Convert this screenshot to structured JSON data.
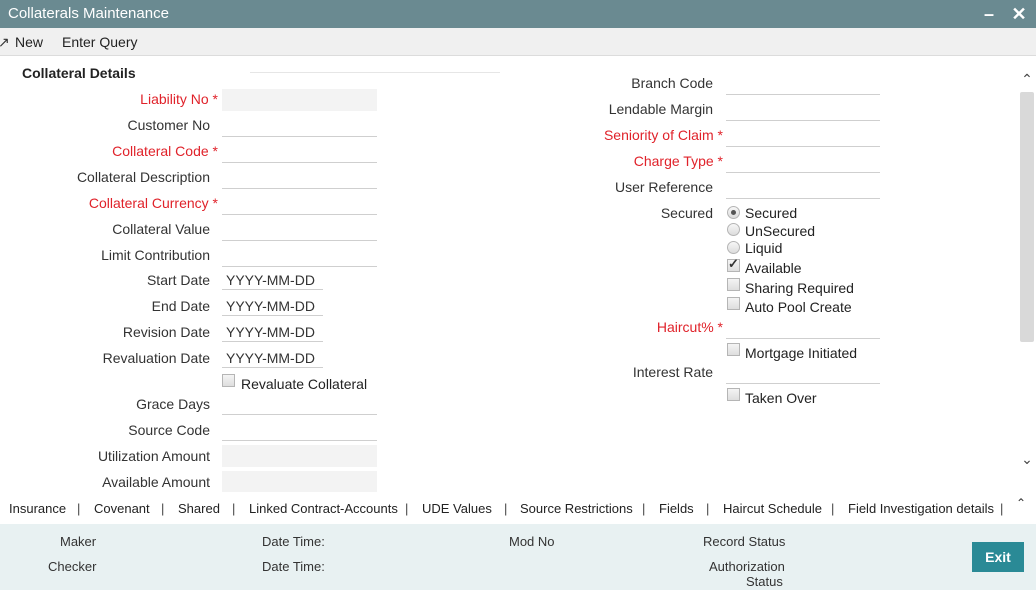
{
  "window": {
    "title": "Collaterals Maintenance",
    "minimize": "–",
    "close": "✕"
  },
  "toolbar": {
    "new_label": "New",
    "enter_query_label": "Enter Query"
  },
  "section": {
    "title": "Collateral Details"
  },
  "left_fields": [
    {
      "label": "Liability No",
      "required": true
    },
    {
      "label": "Customer No",
      "required": false
    },
    {
      "label": "Collateral Code",
      "required": true
    },
    {
      "label": "Collateral Description",
      "required": false
    },
    {
      "label": "Collateral Currency",
      "required": true
    },
    {
      "label": "Collateral Value",
      "required": false
    },
    {
      "label": "Limit Contribution",
      "required": false
    },
    {
      "label": "Start Date",
      "value": "YYYY-MM-DD"
    },
    {
      "label": "End Date",
      "value": "YYYY-MM-DD"
    },
    {
      "label": "Revision Date",
      "value": "YYYY-MM-DD"
    },
    {
      "label": "Revaluation Date",
      "value": "YYYY-MM-DD"
    },
    {
      "label": "Grace Days"
    },
    {
      "label": "Source Code"
    },
    {
      "label": "Utilization Amount"
    },
    {
      "label": "Available Amount"
    }
  ],
  "revaluate_collateral": {
    "label": "Revaluate Collateral",
    "checked": false
  },
  "required_mark": "*",
  "right_fields": [
    {
      "label": "Branch Code",
      "required": false
    },
    {
      "label": "Lendable Margin",
      "required": false
    },
    {
      "label": "Seniority of Claim",
      "required": true
    },
    {
      "label": "Charge Type",
      "required": true
    },
    {
      "label": "User Reference",
      "required": false
    }
  ],
  "secured": {
    "label": "Secured",
    "options": [
      "Secured",
      "UnSecured",
      "Liquid"
    ],
    "selected": "Secured"
  },
  "checkboxes": [
    {
      "label": "Available",
      "checked": true
    },
    {
      "label": "Sharing Required",
      "checked": false
    },
    {
      "label": "Auto Pool Create",
      "checked": false
    }
  ],
  "haircut": {
    "label": "Haircut%",
    "required": true
  },
  "mortgage_initiated": {
    "label": "Mortgage Initiated",
    "checked": false
  },
  "interest_rate": {
    "label": "Interest Rate"
  },
  "taken_over": {
    "label": "Taken Over",
    "checked": false
  },
  "tabs": [
    "Insurance",
    "Covenant",
    "Shared",
    "Linked Contract-Accounts",
    "UDE Values",
    "Source Restrictions",
    "Fields",
    "Haircut Schedule",
    "Field Investigation details"
  ],
  "tab_separator": "|",
  "footer": {
    "maker": "Maker",
    "checker": "Checker",
    "date_time": "Date Time:",
    "mod_no": "Mod No",
    "record_status": "Record Status",
    "authorization_status_line1": "Authorization",
    "authorization_status_line2": "Status",
    "exit_label": "Exit"
  },
  "colors": {
    "titlebar": "#6a8a91",
    "required": "#e0222a",
    "footer": "#e8f1f2",
    "exit_button": "#2a8a96"
  }
}
